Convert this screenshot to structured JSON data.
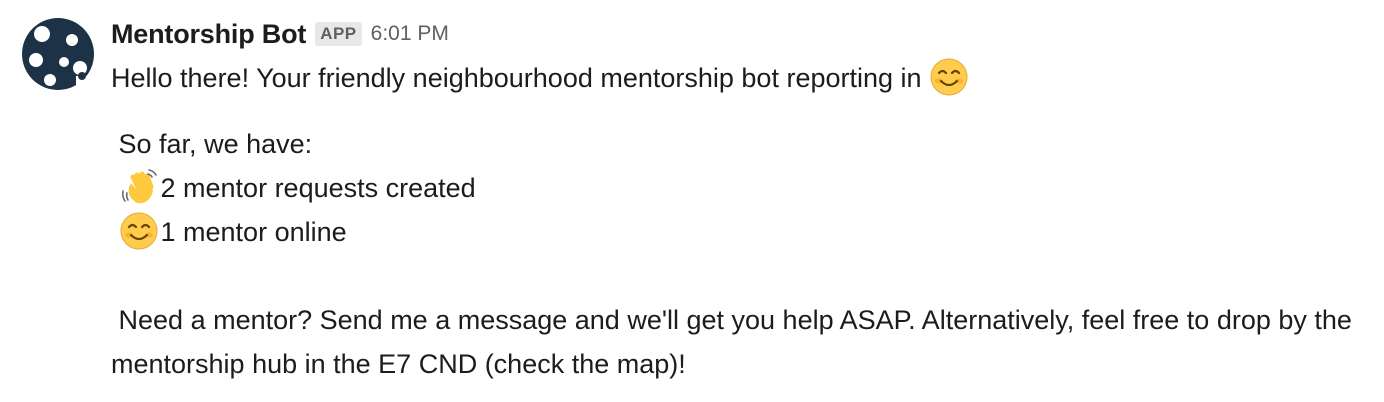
{
  "message": {
    "sender": "Mentorship Bot",
    "badge": "APP",
    "timestamp": "6:01 PM",
    "greeting": "Hello there! Your friendly neighbourhood mentorship bot reporting in",
    "greeting_emoji": "smiling-face-icon",
    "summary_intro": "So far, we have:",
    "stats": [
      {
        "emoji": "waving-hand-icon",
        "text": "2 mentor requests created"
      },
      {
        "emoji": "smiling-face-icon",
        "text": "1 mentor online"
      }
    ],
    "cta": "Need a mentor? Send me a message and we'll get you help ASAP. Alternatively, feel free to drop by the mentorship hub in the E7 CND (check the map)!"
  },
  "colors": {
    "avatar": "#1d3246",
    "text": "#1d1c1d",
    "muted": "#616061",
    "badge_bg": "#e8e8e8",
    "emoji_face": "#ffcc4d",
    "hand": "#ffc83d"
  }
}
